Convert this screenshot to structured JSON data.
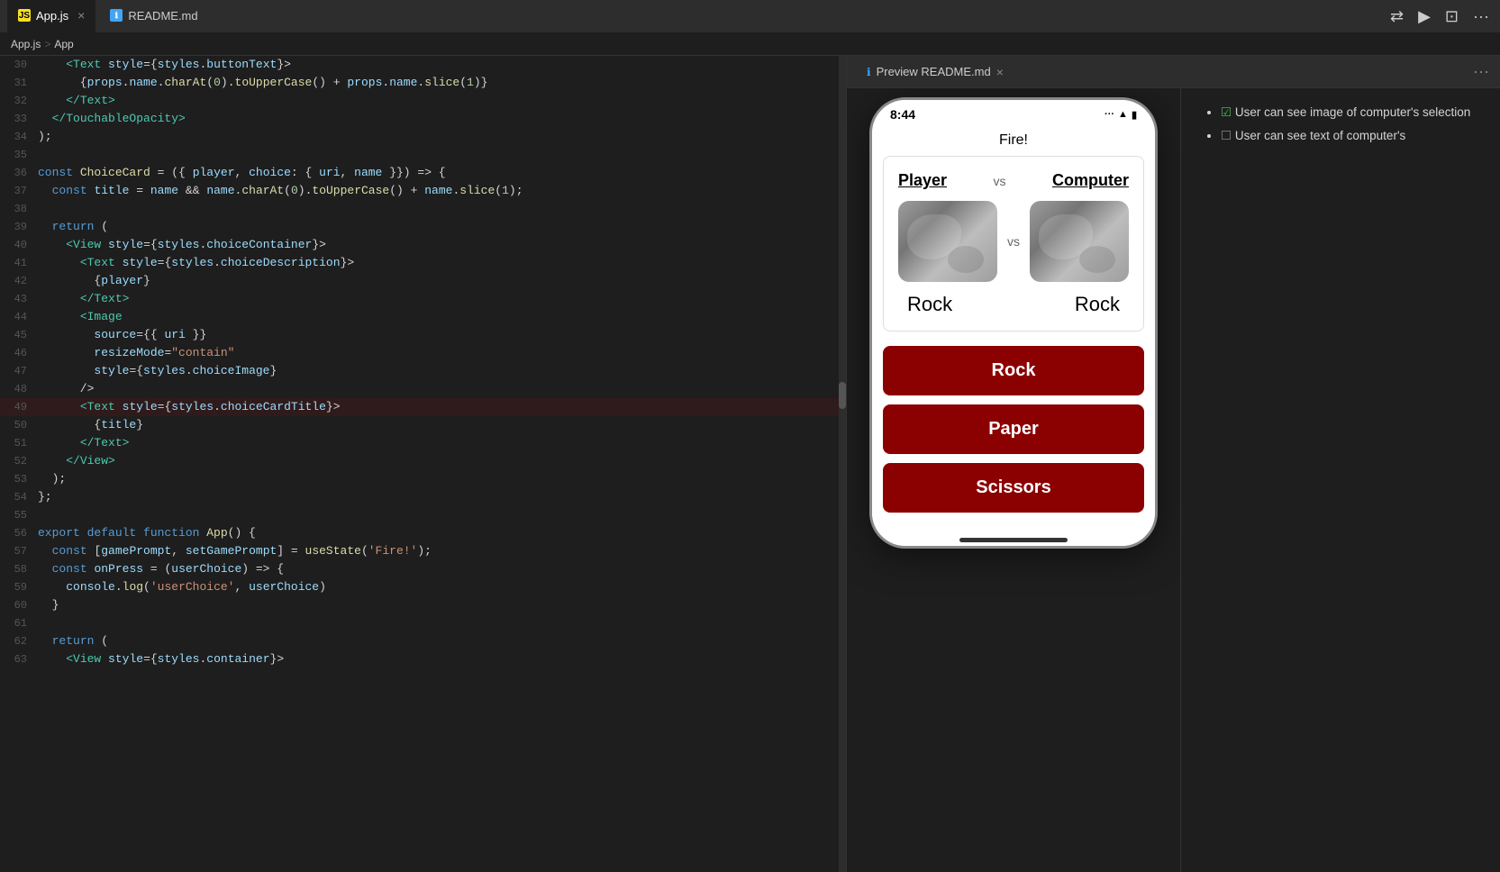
{
  "tabs": [
    {
      "id": "app-js",
      "icon": "js",
      "label": "App.js",
      "active": true,
      "closeable": true
    },
    {
      "id": "readme-md",
      "icon": "md",
      "label": "README.md",
      "active": false,
      "closeable": false
    }
  ],
  "preview_tab": {
    "label": "Preview README.md"
  },
  "breadcrumb": {
    "items": [
      "App.js",
      ">",
      "App"
    ]
  },
  "code": {
    "lines": [
      {
        "num": 30,
        "content": "    <Text style={styles.buttonText}>"
      },
      {
        "num": 31,
        "content": "      {props.name.charAt(0).toUpperCase() + props.name.slice(1)}"
      },
      {
        "num": 32,
        "content": "    </Text>"
      },
      {
        "num": 33,
        "content": "  </TouchableOpacity>"
      },
      {
        "num": 34,
        "content": ");"
      },
      {
        "num": 35,
        "content": ""
      },
      {
        "num": 36,
        "content": "const ChoiceCard = ({ player, choice: { uri, name }}) => {"
      },
      {
        "num": 37,
        "content": "  const title = name && name.charAt(0).toUpperCase() + name.slice(1);"
      },
      {
        "num": 38,
        "content": ""
      },
      {
        "num": 39,
        "content": "  return ("
      },
      {
        "num": 40,
        "content": "    <View style={styles.choiceContainer}>"
      },
      {
        "num": 41,
        "content": "      <Text style={styles.choiceDescription}>"
      },
      {
        "num": 42,
        "content": "        {player}"
      },
      {
        "num": 43,
        "content": "      </Text>"
      },
      {
        "num": 44,
        "content": "      <Image"
      },
      {
        "num": 45,
        "content": "        source={{ uri }}"
      },
      {
        "num": 46,
        "content": "        resizeMode=\"contain\""
      },
      {
        "num": 47,
        "content": "        style={styles.choiceImage}"
      },
      {
        "num": 48,
        "content": "      />"
      },
      {
        "num": 49,
        "content": "      <Text style={styles.choiceCardTitle}>"
      },
      {
        "num": 50,
        "content": "        {title}"
      },
      {
        "num": 51,
        "content": "      </Text>"
      },
      {
        "num": 52,
        "content": "    </View>"
      },
      {
        "num": 53,
        "content": "  );"
      },
      {
        "num": 54,
        "content": "};"
      },
      {
        "num": 55,
        "content": ""
      },
      {
        "num": 56,
        "content": "export default function App() {"
      },
      {
        "num": 57,
        "content": "  const [gamePrompt, setGamePrompt] = useState('Fire!');"
      },
      {
        "num": 58,
        "content": "  const onPress = (userChoice) => {"
      },
      {
        "num": 59,
        "content": "    console.log('userChoice', userChoice)"
      },
      {
        "num": 60,
        "content": "  }"
      },
      {
        "num": 61,
        "content": ""
      },
      {
        "num": 62,
        "content": "  return ("
      },
      {
        "num": 63,
        "content": "    <View style={styles.container}>"
      }
    ]
  },
  "phone": {
    "status_time": "8:44",
    "fire_title": "Fire!",
    "player_label": "Player",
    "computer_label": "Computer",
    "vs_text": "vs",
    "player_choice": "Rock",
    "computer_choice": "Rock",
    "buttons": [
      {
        "label": "Rock"
      },
      {
        "label": "Paper"
      },
      {
        "label": "Scissors"
      }
    ]
  },
  "readme": {
    "items": [
      {
        "checked": true,
        "text": "User can see image of computer's selection"
      },
      {
        "checked": false,
        "text": "User can see text of computer's"
      }
    ]
  }
}
